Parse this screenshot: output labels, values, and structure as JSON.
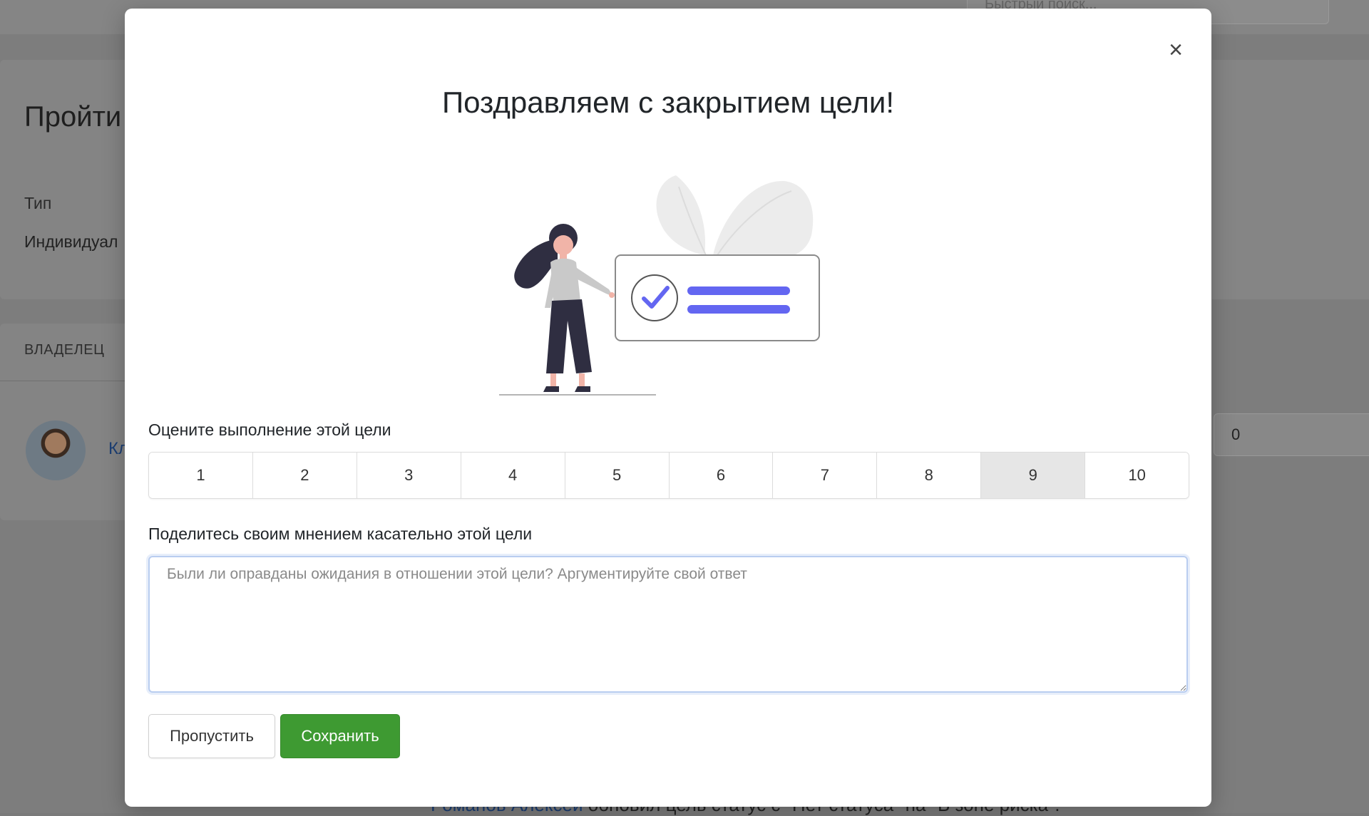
{
  "background": {
    "search_placeholder": "Быстрый поиск...",
    "page_title": "Пройти",
    "type_label": "Тип",
    "type_value": "Индивидуал",
    "owner_section": "ВЛАДЕЛЕЦ",
    "owner_name_fragment": "Кл",
    "right_field_value": "0",
    "activity": {
      "author": "Романов Алексей",
      "text": " обновил цель статус с \"Нет статуса\" на \"В зоне риска\"."
    }
  },
  "modal": {
    "close_label": "×",
    "title": "Поздравляем с закрытием цели!",
    "rating": {
      "label": "Оцените выполнение этой цели",
      "options": [
        "1",
        "2",
        "3",
        "4",
        "5",
        "6",
        "7",
        "8",
        "9",
        "10"
      ],
      "selected": "9"
    },
    "comment": {
      "label": "Поделитесь своим мнением касательно этой цели",
      "placeholder": "Были ли оправданы ожидания в отношении этой цели? Аргументируйте свой ответ",
      "value": ""
    },
    "buttons": {
      "skip": "Пропустить",
      "save": "Сохранить"
    }
  },
  "colors": {
    "accent": "#6366f1",
    "save_button": "#3e9a32",
    "overlay": "#7d7d7d"
  },
  "icons": {
    "close": "close-icon",
    "check": "checkmark-icon"
  }
}
